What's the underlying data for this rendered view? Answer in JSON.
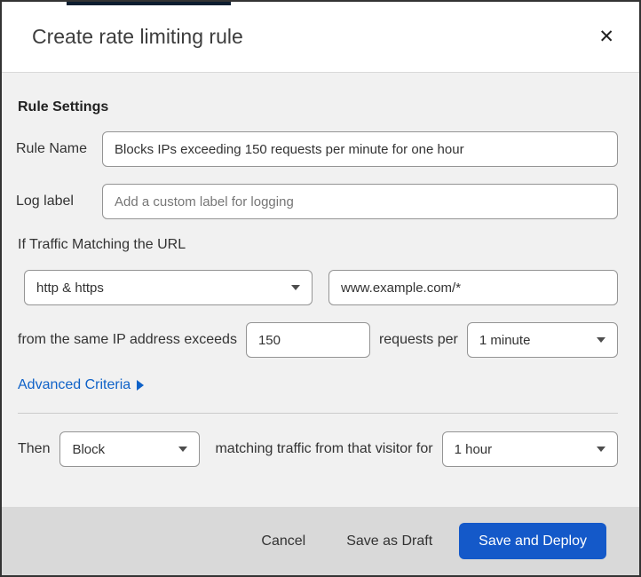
{
  "modal": {
    "title": "Create rate limiting rule"
  },
  "icons": {
    "close": "✕",
    "dropdown_caret": "▼",
    "advanced_arrow": "▶"
  },
  "rule_settings": {
    "heading": "Rule Settings",
    "rule_name": {
      "label": "Rule Name",
      "value": "Blocks IPs exceeding 150 requests per minute for one hour"
    },
    "log_label": {
      "label": "Log label",
      "placeholder": "Add a custom label for logging"
    }
  },
  "criteria": {
    "traffic_heading": "If Traffic Matching the URL",
    "scheme_select": {
      "value": "http & https"
    },
    "url_input": {
      "value": "www.example.com/*"
    },
    "threshold_text_before": "from the same IP address exceeds",
    "requests_value": "150",
    "threshold_text_after": "requests per",
    "period_select": {
      "value": "1 minute"
    },
    "advanced_link_label": "Advanced Criteria"
  },
  "action": {
    "then_label": "Then",
    "action_select": {
      "value": "Block"
    },
    "middle_text": "matching traffic from that visitor for",
    "duration_select": {
      "value": "1 hour"
    }
  },
  "footer": {
    "cancel_label": "Cancel",
    "save_draft_label": "Save as Draft",
    "save_deploy_label": "Save and Deploy"
  },
  "colors": {
    "primary_button_blue": "#1459c9",
    "link_blue": "#0f62c8",
    "footer_gray": "#d9d9d9",
    "body_gray": "#f1f1f1"
  }
}
